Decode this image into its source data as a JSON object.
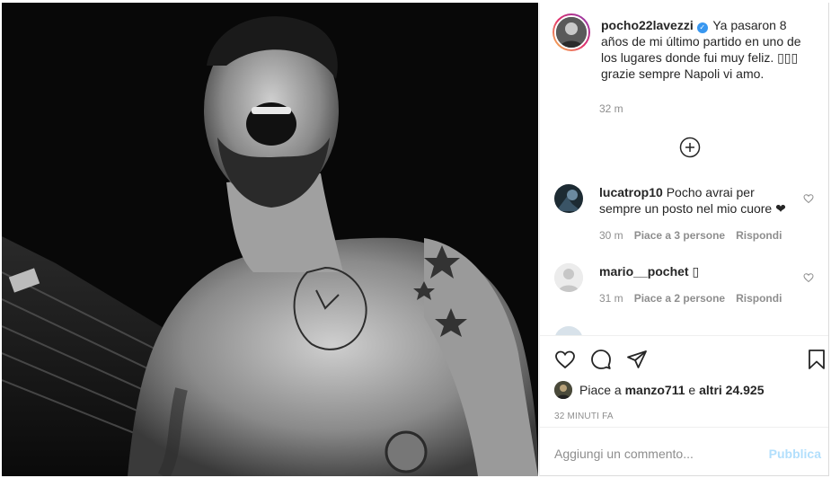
{
  "post": {
    "author": "pocho22lavezzi",
    "verified_badge": "✓",
    "caption": "Ya pasaron 8 años de mi último partido en uno de los lugares donde fui muy feliz. ▯▯▯ grazie sempre Napoli vi amo.",
    "caption_time": "32 m"
  },
  "comments": [
    {
      "username": "lucatrop10",
      "text": "Pocho avrai per sempre un posto nel mio cuore ❤",
      "time": "30 m",
      "likes": "Piace a 3 persone",
      "reply": "Rispondi"
    },
    {
      "username": "mario__pochet",
      "text": "▯",
      "time": "31 m",
      "likes": "Piace a 2 persone",
      "reply": "Rispondi"
    }
  ],
  "likes_bar": {
    "prefix": "Piace a",
    "user": "manzo711",
    "connector": "e",
    "others": "altri 24.925"
  },
  "timestamp": "32 MINUTI FA",
  "comment_box": {
    "placeholder": "Aggiungi un commento...",
    "publish_label": "Pubblica"
  },
  "icons": {
    "load_more": "plus-circle-icon",
    "like": "heart-icon",
    "comment": "comment-icon",
    "share": "paper-plane-icon",
    "save": "bookmark-icon"
  },
  "colors": {
    "verified": "#3897f0",
    "publish_disabled": "#b2dffc",
    "secondary_text": "#8e8e8e"
  }
}
